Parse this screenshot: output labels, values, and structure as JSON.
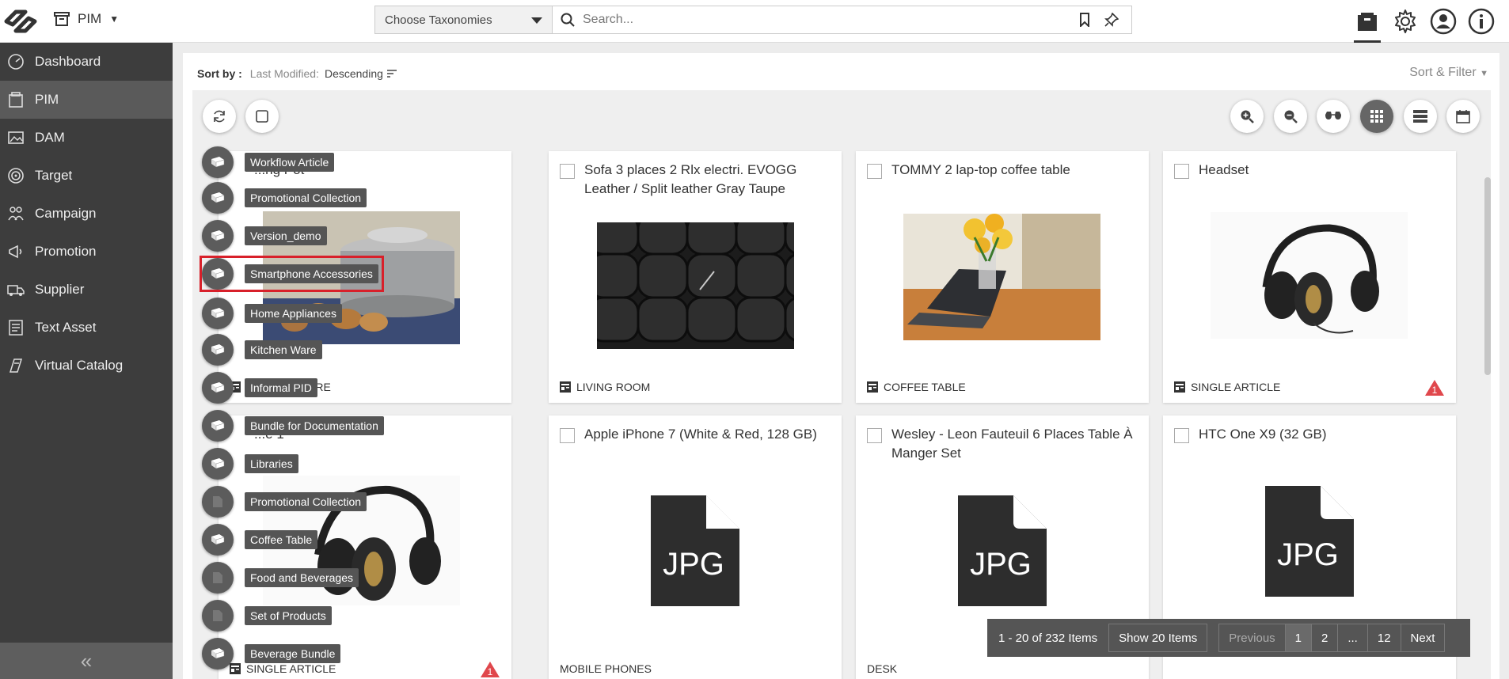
{
  "header": {
    "module": "PIM",
    "taxonomy_placeholder": "Choose Taxonomies",
    "search_placeholder": "Search..."
  },
  "sidebar": {
    "items": [
      {
        "label": "Dashboard",
        "icon": "dashboard-icon"
      },
      {
        "label": "PIM",
        "icon": "pim-icon"
      },
      {
        "label": "DAM",
        "icon": "dam-icon"
      },
      {
        "label": "Target",
        "icon": "target-icon"
      },
      {
        "label": "Campaign",
        "icon": "campaign-icon"
      },
      {
        "label": "Promotion",
        "icon": "promotion-icon"
      },
      {
        "label": "Supplier",
        "icon": "supplier-icon"
      },
      {
        "label": "Text Asset",
        "icon": "text-asset-icon"
      },
      {
        "label": "Virtual Catalog",
        "icon": "virtual-catalog-icon"
      }
    ]
  },
  "sort": {
    "label": "Sort by :",
    "field": "Last Modified:",
    "direction": "Descending",
    "filter_label": "Sort & Filter"
  },
  "cards": [
    {
      "title": "...ng Pot",
      "category": "KITCHEN WARE"
    },
    {
      "title": "Sofa 3 places 2 Rlx electri. EVOGG Leather / Split leather Gray Taupe",
      "category": "LIVING ROOM"
    },
    {
      "title": "TOMMY 2 lap-top coffee table",
      "category": "COFFEE TABLE"
    },
    {
      "title": "Headset",
      "category": "SINGLE ARTICLE",
      "warning": "1"
    },
    {
      "title": "...e 1",
      "category": "SINGLE ARTICLE",
      "warning": "1"
    },
    {
      "title": "Apple iPhone 7 (White & Red, 128 GB)",
      "category": "MOBILE PHONES",
      "file": "JPG"
    },
    {
      "title": "Wesley - Leon Fauteuil 6 Places Table À Manger Set",
      "category": "DESK",
      "file": "JPG"
    },
    {
      "title": "HTC One X9 (32 GB)",
      "category": "",
      "file": "JPG"
    }
  ],
  "overlay_menu": [
    "Workflow Article",
    "Promotional Collection",
    "Version_demo",
    "Smartphone Accessories",
    "Home Appliances",
    "Kitchen Ware",
    "Informal PID",
    "Bundle for Documentation",
    "Libraries",
    "Promotional Collection",
    "Coffee Table",
    "Food and Beverages",
    "Set of Products",
    "Beverage Bundle"
  ],
  "pagination": {
    "count_label": "1 - 20 of 232 Items",
    "show_label": "Show 20 Items",
    "previous": "Previous",
    "pages": [
      "1",
      "2",
      "...",
      "12"
    ],
    "next": "Next"
  },
  "colors": {
    "sidebar_bg": "#3d3d3d",
    "sidebar_active": "#5a5a5a",
    "warning_red": "#e0474c",
    "highlight_red": "#d8202a"
  }
}
